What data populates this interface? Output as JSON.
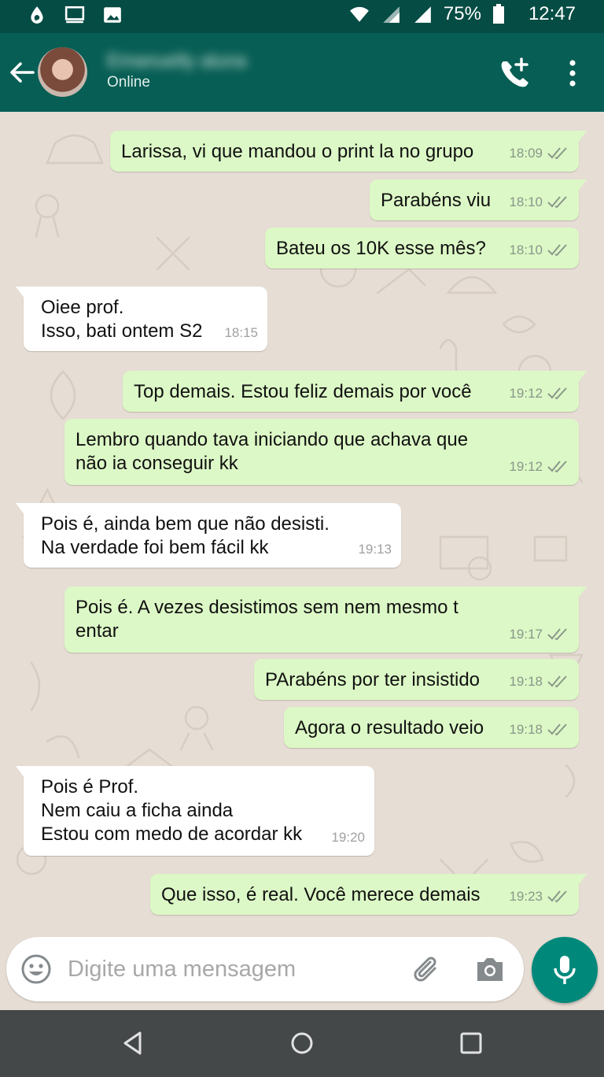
{
  "status_bar": {
    "battery_percent": "75%",
    "time": "12:47",
    "left_icons": [
      "droplet-icon",
      "cast-icon",
      "image-icon"
    ],
    "right_icons": [
      "wifi-icon",
      "signal-icon",
      "signal-icon",
      "battery-icon"
    ]
  },
  "header": {
    "contact_name": "Emanuelly aluna",
    "status": "Online",
    "icons": [
      "back-arrow-icon",
      "add-call-icon",
      "more-vert-icon"
    ]
  },
  "messages": [
    {
      "dir": "out",
      "text": "Larissa, vi que mandou o print la no grupo",
      "time": "18:09"
    },
    {
      "dir": "out",
      "text": "Parabéns viu",
      "time": "18:10"
    },
    {
      "dir": "out",
      "text": "Bateu os 10K esse mês?",
      "time": "18:10"
    },
    {
      "dir": "in",
      "text": "Oiee prof.\nIsso, bati ontem S2",
      "time": "18:15"
    },
    {
      "dir": "out",
      "text": "Top demais. Estou feliz demais por você",
      "time": "19:12"
    },
    {
      "dir": "out",
      "text": "Lembro quando tava iniciando que achava que\nnão ia conseguir kk",
      "time": "19:12"
    },
    {
      "dir": "in",
      "text": "Pois é, ainda bem que não desisti.\nNa verdade foi bem fácil kk",
      "time": "19:13"
    },
    {
      "dir": "out",
      "text": "Pois é. A vezes desistimos sem nem mesmo t\nentar",
      "time": "19:17"
    },
    {
      "dir": "out",
      "text": "PArabéns por ter insistido",
      "time": "19:18"
    },
    {
      "dir": "out",
      "text": "Agora o resultado veio",
      "time": "19:18"
    },
    {
      "dir": "in",
      "text": "Pois é Prof.\nNem caiu a ficha ainda\nEstou com medo de acordar kk",
      "time": "19:20"
    },
    {
      "dir": "out",
      "text": "Que isso, é real. Você merece demais",
      "time": "19:23"
    }
  ],
  "composer": {
    "placeholder": "Digite uma mensagem",
    "value": ""
  },
  "colors": {
    "header": "#075e54",
    "status_bar": "#054c44",
    "outgoing_bubble": "#dcf8c6",
    "incoming_bubble": "#ffffff",
    "mic_button": "#00897b",
    "chat_background": "#e6ddd4"
  }
}
